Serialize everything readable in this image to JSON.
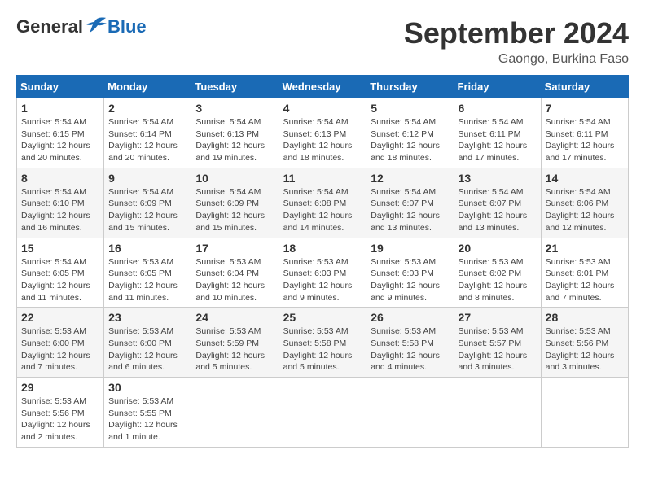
{
  "header": {
    "logo": {
      "general": "General",
      "blue": "Blue"
    },
    "title": "September 2024",
    "location": "Gaongo, Burkina Faso"
  },
  "weekdays": [
    "Sunday",
    "Monday",
    "Tuesday",
    "Wednesday",
    "Thursday",
    "Friday",
    "Saturday"
  ],
  "weeks": [
    [
      {
        "day": "1",
        "sunrise": "5:54 AM",
        "sunset": "6:15 PM",
        "daylight": "12 hours and 20 minutes."
      },
      {
        "day": "2",
        "sunrise": "5:54 AM",
        "sunset": "6:14 PM",
        "daylight": "12 hours and 20 minutes."
      },
      {
        "day": "3",
        "sunrise": "5:54 AM",
        "sunset": "6:13 PM",
        "daylight": "12 hours and 19 minutes."
      },
      {
        "day": "4",
        "sunrise": "5:54 AM",
        "sunset": "6:13 PM",
        "daylight": "12 hours and 18 minutes."
      },
      {
        "day": "5",
        "sunrise": "5:54 AM",
        "sunset": "6:12 PM",
        "daylight": "12 hours and 18 minutes."
      },
      {
        "day": "6",
        "sunrise": "5:54 AM",
        "sunset": "6:11 PM",
        "daylight": "12 hours and 17 minutes."
      },
      {
        "day": "7",
        "sunrise": "5:54 AM",
        "sunset": "6:11 PM",
        "daylight": "12 hours and 17 minutes."
      }
    ],
    [
      {
        "day": "8",
        "sunrise": "5:54 AM",
        "sunset": "6:10 PM",
        "daylight": "12 hours and 16 minutes."
      },
      {
        "day": "9",
        "sunrise": "5:54 AM",
        "sunset": "6:09 PM",
        "daylight": "12 hours and 15 minutes."
      },
      {
        "day": "10",
        "sunrise": "5:54 AM",
        "sunset": "6:09 PM",
        "daylight": "12 hours and 15 minutes."
      },
      {
        "day": "11",
        "sunrise": "5:54 AM",
        "sunset": "6:08 PM",
        "daylight": "12 hours and 14 minutes."
      },
      {
        "day": "12",
        "sunrise": "5:54 AM",
        "sunset": "6:07 PM",
        "daylight": "12 hours and 13 minutes."
      },
      {
        "day": "13",
        "sunrise": "5:54 AM",
        "sunset": "6:07 PM",
        "daylight": "12 hours and 13 minutes."
      },
      {
        "day": "14",
        "sunrise": "5:54 AM",
        "sunset": "6:06 PM",
        "daylight": "12 hours and 12 minutes."
      }
    ],
    [
      {
        "day": "15",
        "sunrise": "5:54 AM",
        "sunset": "6:05 PM",
        "daylight": "12 hours and 11 minutes."
      },
      {
        "day": "16",
        "sunrise": "5:53 AM",
        "sunset": "6:05 PM",
        "daylight": "12 hours and 11 minutes."
      },
      {
        "day": "17",
        "sunrise": "5:53 AM",
        "sunset": "6:04 PM",
        "daylight": "12 hours and 10 minutes."
      },
      {
        "day": "18",
        "sunrise": "5:53 AM",
        "sunset": "6:03 PM",
        "daylight": "12 hours and 9 minutes."
      },
      {
        "day": "19",
        "sunrise": "5:53 AM",
        "sunset": "6:03 PM",
        "daylight": "12 hours and 9 minutes."
      },
      {
        "day": "20",
        "sunrise": "5:53 AM",
        "sunset": "6:02 PM",
        "daylight": "12 hours and 8 minutes."
      },
      {
        "day": "21",
        "sunrise": "5:53 AM",
        "sunset": "6:01 PM",
        "daylight": "12 hours and 7 minutes."
      }
    ],
    [
      {
        "day": "22",
        "sunrise": "5:53 AM",
        "sunset": "6:00 PM",
        "daylight": "12 hours and 7 minutes."
      },
      {
        "day": "23",
        "sunrise": "5:53 AM",
        "sunset": "6:00 PM",
        "daylight": "12 hours and 6 minutes."
      },
      {
        "day": "24",
        "sunrise": "5:53 AM",
        "sunset": "5:59 PM",
        "daylight": "12 hours and 5 minutes."
      },
      {
        "day": "25",
        "sunrise": "5:53 AM",
        "sunset": "5:58 PM",
        "daylight": "12 hours and 5 minutes."
      },
      {
        "day": "26",
        "sunrise": "5:53 AM",
        "sunset": "5:58 PM",
        "daylight": "12 hours and 4 minutes."
      },
      {
        "day": "27",
        "sunrise": "5:53 AM",
        "sunset": "5:57 PM",
        "daylight": "12 hours and 3 minutes."
      },
      {
        "day": "28",
        "sunrise": "5:53 AM",
        "sunset": "5:56 PM",
        "daylight": "12 hours and 3 minutes."
      }
    ],
    [
      {
        "day": "29",
        "sunrise": "5:53 AM",
        "sunset": "5:56 PM",
        "daylight": "12 hours and 2 minutes."
      },
      {
        "day": "30",
        "sunrise": "5:53 AM",
        "sunset": "5:55 PM",
        "daylight": "12 hours and 1 minute."
      },
      null,
      null,
      null,
      null,
      null
    ]
  ]
}
